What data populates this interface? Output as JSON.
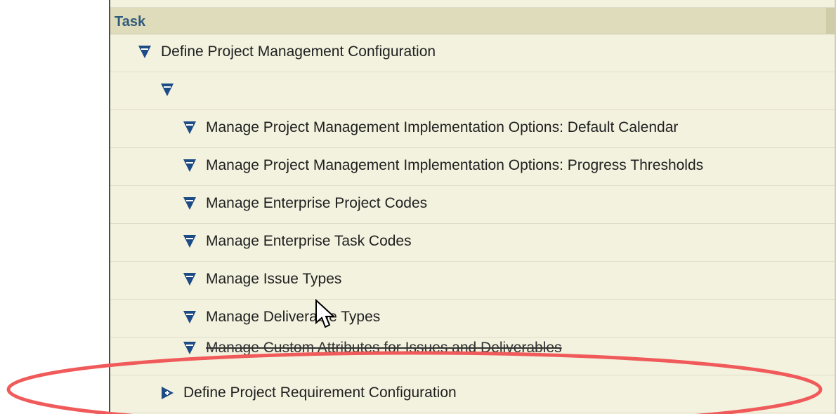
{
  "header": {
    "task_label": "Task"
  },
  "tree": {
    "root_label": "Define Project Management Configuration",
    "empty_node_label": "",
    "children": [
      {
        "label": "Manage Project Management Implementation Options: Default Calendar"
      },
      {
        "label": "Manage Project Management Implementation Options: Progress Thresholds"
      },
      {
        "label": "Manage Enterprise Project Codes"
      },
      {
        "label": "Manage Enterprise Task Codes"
      },
      {
        "label": "Manage Issue Types"
      },
      {
        "label": "Manage Deliverable Types"
      },
      {
        "label": "Manage Custom Attributes for Issues and Deliverables"
      }
    ],
    "collapsed_label": "Define Project Requirement Configuration"
  },
  "icons": {
    "expanded": "expanded-triangle-icon",
    "collapsed": "collapsed-triangle-icon",
    "cursor": "mouse-cursor-icon"
  },
  "colors": {
    "table_background": "#f3f2df",
    "header_background": "#dedcba",
    "header_text": "#2f5a7a",
    "icon_blue": "#1d4b86",
    "highlight_red": "#f05a5a"
  }
}
